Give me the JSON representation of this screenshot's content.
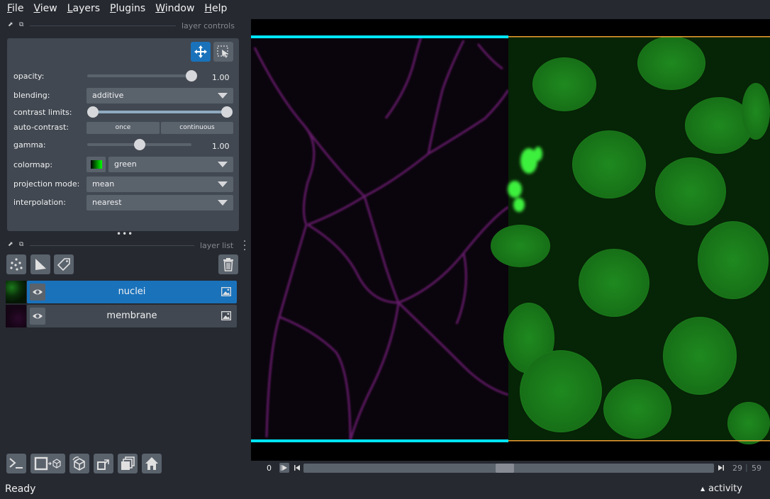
{
  "menu": [
    "File",
    "View",
    "Layers",
    "Plugins",
    "Window",
    "Help"
  ],
  "layer_controls": {
    "title": "layer controls",
    "opacity_label": "opacity:",
    "opacity_value": "1.00",
    "opacity_level": 1.0,
    "blending_label": "blending:",
    "blending_value": "additive",
    "contrast_label": "contrast limits:",
    "contrast_range": [
      0.0,
      1.0
    ],
    "autocontrast_label": "auto-contrast:",
    "autocontrast_once": "once",
    "autocontrast_continuous": "continuous",
    "gamma_label": "gamma:",
    "gamma_value": "1.00",
    "gamma_level": 0.5,
    "colormap_label": "colormap:",
    "colormap_value": "green",
    "projection_label": "projection mode:",
    "projection_value": "mean",
    "interpolation_label": "interpolation:",
    "interpolation_value": "nearest",
    "colors": {
      "panel": "#414851",
      "control": "#5a626c",
      "accent": "#1a72bb"
    }
  },
  "layer_list": {
    "title": "layer list",
    "layers": [
      {
        "name": "nuclei",
        "selected": true,
        "type_icon": "image-icon"
      },
      {
        "name": "membrane",
        "selected": false,
        "type_icon": "image-icon"
      }
    ]
  },
  "dims": {
    "current": "0",
    "slider_value": "29",
    "slider_max": "59",
    "slider_fraction": 0.49
  },
  "status": {
    "text": "Ready",
    "activity": "activity"
  },
  "canvas_colors": {
    "membrane": "#8a2a8f",
    "nuclei": "#2fbf2f",
    "selection_top": "#00e5ff",
    "selection_alt": "#f0a030"
  }
}
